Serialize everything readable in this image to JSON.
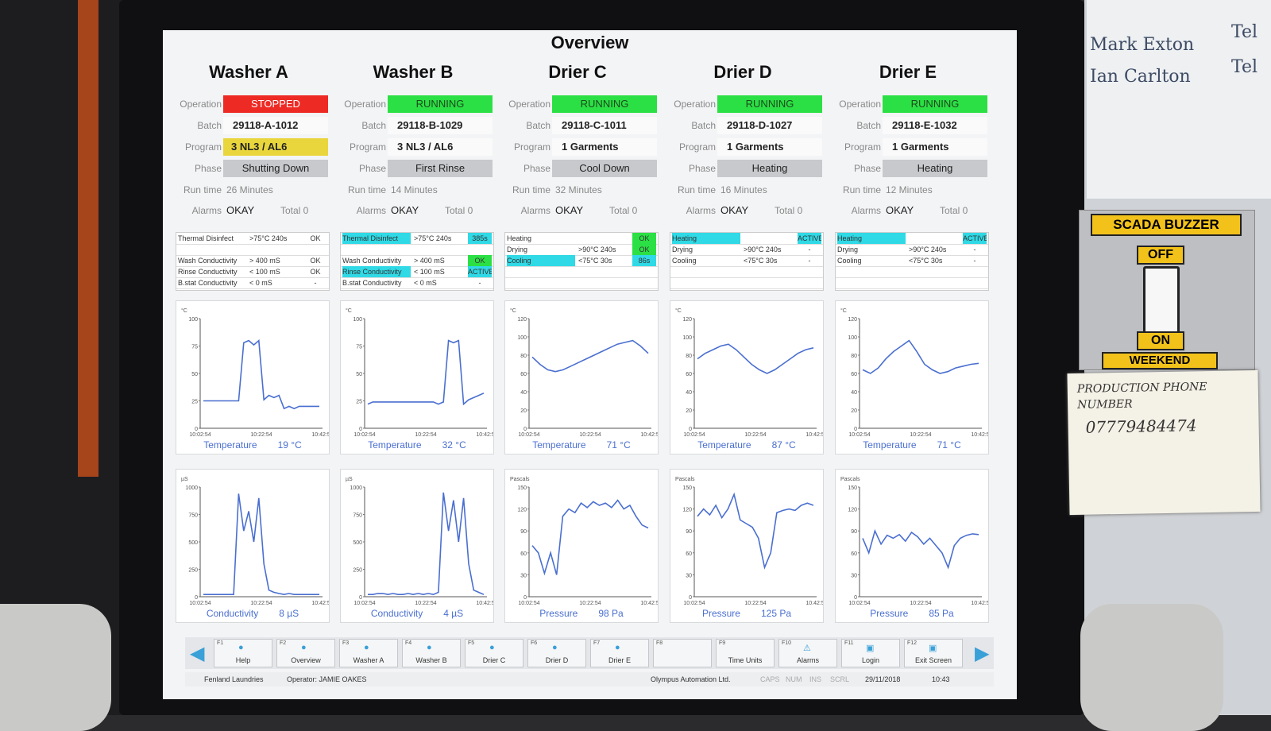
{
  "screen": {
    "title": "Overview"
  },
  "units": [
    {
      "name": "Washer A",
      "operation_label": "Operation",
      "operation": "STOPPED",
      "op_state": "stopped",
      "batch_label": "Batch",
      "batch": "29118-A-1012",
      "program_label": "Program",
      "program": "3 NL3 / AL6",
      "program_highlight": true,
      "phase_label": "Phase",
      "phase": "Shutting Down",
      "runtime_label": "Run time",
      "runtime": "26 Minutes",
      "alarms_label": "Alarms",
      "alarms": "OKAY",
      "total": "Total 0",
      "steps": [
        {
          "name": "Thermal Disinfect",
          "cond": ">75°C 240s",
          "status": "OK",
          "hl_name": false,
          "hl_status": false
        },
        {
          "name": "",
          "cond": "",
          "status": "",
          "hl_name": false,
          "hl_status": false
        },
        {
          "name": "Wash Conductivity",
          "cond": "> 400 mS",
          "status": "OK",
          "hl_name": false,
          "hl_status": false
        },
        {
          "name": "Rinse Conductivity",
          "cond": "< 100 mS",
          "status": "OK",
          "hl_name": false,
          "hl_status": false
        },
        {
          "name": "B.stat Conductivity",
          "cond": "< 0 mS",
          "status": "-",
          "hl_name": false,
          "hl_status": false
        }
      ],
      "temp_chart": {
        "unit": "°C",
        "caption": "Temperature",
        "reading": "19 °C",
        "yticks": [
          "100",
          "75",
          "50",
          "25",
          "0"
        ],
        "ymax": 100,
        "xticks": [
          "10:02:54",
          "10:22:54",
          "10:42:54"
        ],
        "values": [
          25,
          25,
          25,
          25,
          25,
          25,
          25,
          25,
          78,
          80,
          76,
          80,
          26,
          30,
          28,
          30,
          18,
          20,
          18,
          20,
          20,
          20,
          20,
          20
        ]
      },
      "second_chart": {
        "unit": "µS",
        "caption": "Conductivity",
        "reading": "8 µS",
        "yticks": [
          "1000",
          "750",
          "500",
          "250",
          "0"
        ],
        "ymax": 1000,
        "xticks": [
          "10:02:54",
          "10:22:54",
          "10:42:54"
        ],
        "values": [
          20,
          20,
          20,
          20,
          20,
          20,
          20,
          940,
          600,
          780,
          500,
          900,
          300,
          60,
          40,
          30,
          20,
          30,
          20,
          20,
          20,
          20,
          20,
          20
        ]
      }
    },
    {
      "name": "Washer B",
      "operation_label": "Operation",
      "operation": "RUNNING",
      "op_state": "running",
      "batch_label": "Batch",
      "batch": "29118-B-1029",
      "program_label": "Program",
      "program": "3 NL3 / AL6",
      "program_highlight": false,
      "phase_label": "Phase",
      "phase": "First Rinse",
      "runtime_label": "Run time",
      "runtime": "14 Minutes",
      "alarms_label": "Alarms",
      "alarms": "OKAY",
      "total": "Total 0",
      "steps": [
        {
          "name": "Thermal Disinfect",
          "cond": ">75°C 240s",
          "status": "385s",
          "hl_name": true,
          "hl_status": true
        },
        {
          "name": "",
          "cond": "",
          "status": "",
          "hl_name": false,
          "hl_status": false
        },
        {
          "name": "Wash Conductivity",
          "cond": "> 400 mS",
          "status": "OK",
          "hl_name": false,
          "hl_status": false,
          "ok": true
        },
        {
          "name": "Rinse Conductivity",
          "cond": "< 100 mS",
          "status": "ACTIVE",
          "hl_name": true,
          "hl_status": true
        },
        {
          "name": "B.stat Conductivity",
          "cond": "< 0 mS",
          "status": "-",
          "hl_name": false,
          "hl_status": false
        }
      ],
      "temp_chart": {
        "unit": "°C",
        "caption": "Temperature",
        "reading": "32 °C",
        "yticks": [
          "100",
          "75",
          "50",
          "25",
          "0"
        ],
        "ymax": 100,
        "xticks": [
          "10:02:54",
          "10:22:54",
          "10:42:54"
        ],
        "values": [
          22,
          24,
          24,
          24,
          24,
          24,
          24,
          24,
          24,
          24,
          24,
          24,
          24,
          24,
          22,
          24,
          80,
          78,
          80,
          22,
          26,
          28,
          30,
          32
        ]
      },
      "second_chart": {
        "unit": "µS",
        "caption": "Conductivity",
        "reading": "4 µS",
        "yticks": [
          "1000",
          "750",
          "500",
          "250",
          "0"
        ],
        "ymax": 1000,
        "xticks": [
          "10:02:54",
          "10:22:54",
          "10:42:54"
        ],
        "values": [
          20,
          20,
          30,
          30,
          20,
          30,
          20,
          20,
          30,
          20,
          30,
          20,
          30,
          20,
          40,
          950,
          600,
          880,
          500,
          900,
          300,
          60,
          40,
          20
        ]
      }
    },
    {
      "name": "Drier C",
      "operation_label": "Operation",
      "operation": "RUNNING",
      "op_state": "running",
      "batch_label": "Batch",
      "batch": "29118-C-1011",
      "program_label": "Program",
      "program": "1 Garments",
      "program_highlight": false,
      "phase_label": "Phase",
      "phase": "Cool Down",
      "runtime_label": "Run time",
      "runtime": "32 Minutes",
      "alarms_label": "Alarms",
      "alarms": "OKAY",
      "total": "Total 0",
      "steps": [
        {
          "name": "Heating",
          "cond": "",
          "status": "OK",
          "hl_name": false,
          "hl_status": false,
          "ok": true
        },
        {
          "name": "Drying",
          "cond": ">90°C 240s",
          "status": "OK",
          "hl_name": false,
          "hl_status": false,
          "ok": true
        },
        {
          "name": "Cooling",
          "cond": "<75°C 30s",
          "status": "86s",
          "hl_name": true,
          "hl_status": true
        },
        {
          "name": "",
          "cond": "",
          "status": "",
          "hl_name": false,
          "hl_status": false
        },
        {
          "name": "",
          "cond": "",
          "status": "",
          "hl_name": false,
          "hl_status": false
        }
      ],
      "temp_chart": {
        "unit": "°C",
        "caption": "Temperature",
        "reading": "71 °C",
        "yticks": [
          "120",
          "100",
          "80",
          "60",
          "40",
          "20",
          "0"
        ],
        "ymax": 120,
        "xticks": [
          "10:02:54",
          "10:22:54",
          "10:42:54"
        ],
        "values": [
          78,
          70,
          64,
          62,
          64,
          68,
          72,
          76,
          80,
          84,
          88,
          92,
          94,
          96,
          90,
          82
        ]
      },
      "second_chart": {
        "unit": "Pascals",
        "caption": "Pressure",
        "reading": "98 Pa",
        "yticks": [
          "150",
          "120",
          "90",
          "60",
          "30",
          "0"
        ],
        "ymax": 150,
        "xticks": [
          "10:02:54",
          "10:22:54",
          "10:42:54"
        ],
        "values": [
          70,
          60,
          32,
          60,
          30,
          110,
          120,
          115,
          128,
          122,
          130,
          125,
          128,
          122,
          132,
          120,
          125,
          110,
          98,
          94
        ]
      }
    },
    {
      "name": "Drier D",
      "operation_label": "Operation",
      "operation": "RUNNING",
      "op_state": "running",
      "batch_label": "Batch",
      "batch": "29118-D-1027",
      "program_label": "Program",
      "program": "1 Garments",
      "program_highlight": false,
      "phase_label": "Phase",
      "phase": "Heating",
      "runtime_label": "Run time",
      "runtime": "16 Minutes",
      "alarms_label": "Alarms",
      "alarms": "OKAY",
      "total": "Total 0",
      "steps": [
        {
          "name": "Heating",
          "cond": "",
          "status": "ACTIVE",
          "hl_name": true,
          "hl_status": true
        },
        {
          "name": "Drying",
          "cond": ">90°C 240s",
          "status": "-",
          "hl_name": false,
          "hl_status": false
        },
        {
          "name": "Cooling",
          "cond": "<75°C 30s",
          "status": "-",
          "hl_name": false,
          "hl_status": false
        },
        {
          "name": "",
          "cond": "",
          "status": "",
          "hl_name": false,
          "hl_status": false
        },
        {
          "name": "",
          "cond": "",
          "status": "",
          "hl_name": false,
          "hl_status": false
        }
      ],
      "temp_chart": {
        "unit": "°C",
        "caption": "Temperature",
        "reading": "87 °C",
        "yticks": [
          "120",
          "100",
          "80",
          "60",
          "40",
          "20",
          "0"
        ],
        "ymax": 120,
        "xticks": [
          "10:02:54",
          "10:22:54",
          "10:42:54"
        ],
        "values": [
          76,
          82,
          86,
          90,
          92,
          86,
          78,
          70,
          64,
          60,
          64,
          70,
          76,
          82,
          86,
          88
        ]
      },
      "second_chart": {
        "unit": "Pascals",
        "caption": "Pressure",
        "reading": "125 Pa",
        "yticks": [
          "150",
          "120",
          "90",
          "60",
          "30",
          "0"
        ],
        "ymax": 150,
        "xticks": [
          "10:02:54",
          "10:22:54",
          "10:42:54"
        ],
        "values": [
          110,
          120,
          112,
          125,
          108,
          120,
          140,
          105,
          100,
          95,
          80,
          40,
          60,
          115,
          118,
          120,
          118,
          125,
          128,
          125
        ]
      }
    },
    {
      "name": "Drier E",
      "operation_label": "Operation",
      "operation": "RUNNING",
      "op_state": "running",
      "batch_label": "Batch",
      "batch": "29118-E-1032",
      "program_label": "Program",
      "program": "1 Garments",
      "program_highlight": false,
      "phase_label": "Phase",
      "phase": "Heating",
      "runtime_label": "Run time",
      "runtime": "12 Minutes",
      "alarms_label": "Alarms",
      "alarms": "OKAY",
      "total": "Total 0",
      "steps": [
        {
          "name": "Heating",
          "cond": "",
          "status": "ACTIVE",
          "hl_name": true,
          "hl_status": true
        },
        {
          "name": "Drying",
          "cond": ">90°C 240s",
          "status": "-",
          "hl_name": false,
          "hl_status": false
        },
        {
          "name": "Cooling",
          "cond": "<75°C 30s",
          "status": "-",
          "hl_name": false,
          "hl_status": false
        },
        {
          "name": "",
          "cond": "",
          "status": "",
          "hl_name": false,
          "hl_status": false
        },
        {
          "name": "",
          "cond": "",
          "status": "",
          "hl_name": false,
          "hl_status": false
        }
      ],
      "temp_chart": {
        "unit": "°C",
        "caption": "Temperature",
        "reading": "71 °C",
        "yticks": [
          "120",
          "100",
          "80",
          "60",
          "40",
          "20",
          "0"
        ],
        "ymax": 120,
        "xticks": [
          "10:02:54",
          "10:22:54",
          "10:42:54"
        ],
        "values": [
          64,
          60,
          66,
          76,
          84,
          90,
          96,
          84,
          70,
          64,
          60,
          62,
          66,
          68,
          70,
          71
        ]
      },
      "second_chart": {
        "unit": "Pascals",
        "caption": "Pressure",
        "reading": "85 Pa",
        "yticks": [
          "150",
          "120",
          "90",
          "60",
          "30",
          "0"
        ],
        "ymax": 150,
        "xticks": [
          "10:02:54",
          "10:22:54",
          "10:42:54"
        ],
        "values": [
          80,
          60,
          90,
          72,
          84,
          80,
          85,
          76,
          88,
          82,
          72,
          80,
          70,
          60,
          40,
          70,
          80,
          84,
          86,
          85
        ]
      }
    }
  ],
  "function_keys": [
    {
      "key": "F1",
      "label": "Help",
      "icon": "help-icon"
    },
    {
      "key": "F2",
      "label": "Overview",
      "icon": "overview-icon"
    },
    {
      "key": "F3",
      "label": "Washer A",
      "icon": "washer-icon"
    },
    {
      "key": "F4",
      "label": "Washer B",
      "icon": "washer-icon"
    },
    {
      "key": "F5",
      "label": "Drier C",
      "icon": "drier-icon"
    },
    {
      "key": "F6",
      "label": "Drier D",
      "icon": "drier-icon"
    },
    {
      "key": "F7",
      "label": "Drier E",
      "icon": "drier-icon"
    },
    {
      "key": "F8",
      "label": "",
      "icon": ""
    },
    {
      "key": "F9",
      "label": "Time Units",
      "icon": ""
    },
    {
      "key": "F10",
      "label": "Alarms",
      "icon": "alarm-icon"
    },
    {
      "key": "F11",
      "label": "Login",
      "icon": "login-icon"
    },
    {
      "key": "F12",
      "label": "Exit Screen",
      "icon": "exit-icon"
    }
  ],
  "status_bar": {
    "site": "Fenland Laundries",
    "operator": "Operator: JAMIE OAKES",
    "vendor": "Olympus Automation Ltd.",
    "caps": "CAPS",
    "num": "NUM",
    "ins": "INS",
    "scrl": "SCRL",
    "date": "29/11/2018",
    "time": "10:43"
  },
  "surroundings": {
    "names": [
      "Mark Exton",
      "Ian Carlton"
    ],
    "tel": [
      "Tel",
      "Tel"
    ],
    "buzzer": {
      "title": "SCADA BUZZER",
      "off": "OFF",
      "on": "ON",
      "weekend": "WEEKEND"
    },
    "note": {
      "line1": "PRODUCTION PHONE",
      "line2": "NUMBER",
      "line3": "07779484474"
    }
  },
  "colors": {
    "stopped": "#ee2a24",
    "running": "#2be044",
    "highlight": "#2fd9e5",
    "trend": "#4a6fd0",
    "program_warn": "#e9d63c"
  }
}
